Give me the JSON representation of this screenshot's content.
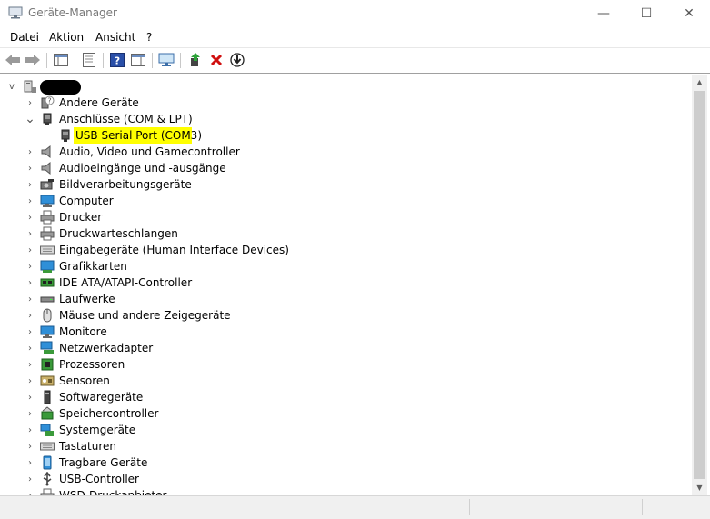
{
  "window": {
    "title": "Geräte-Manager"
  },
  "window_controls": {
    "minimize": "—",
    "maximize": "☐",
    "close": "✕"
  },
  "menu": [
    "Datei",
    "Aktion",
    "Ansicht",
    "?"
  ],
  "tree": {
    "root_expander": "v",
    "collapsed_glyph": "›",
    "expanded_glyph": "⌄",
    "categories": [
      {
        "label": "Andere Geräte",
        "icon": "unknown-device-icon",
        "expanded": false
      },
      {
        "label": "Anschlüsse (COM & LPT)",
        "icon": "port-icon",
        "expanded": true
      },
      {
        "label": "USB Serial Port (COM3)",
        "icon": "usb-serial-port-icon",
        "child": true,
        "selected": true
      },
      {
        "label": "Audio, Video und Gamecontroller",
        "icon": "speaker-icon",
        "expanded": false
      },
      {
        "label": "Audioeingänge und -ausgänge",
        "icon": "speaker-icon",
        "expanded": false
      },
      {
        "label": "Bildverarbeitungsgeräte",
        "icon": "camera-icon",
        "expanded": false
      },
      {
        "label": "Computer",
        "icon": "monitor-icon",
        "expanded": false
      },
      {
        "label": "Drucker",
        "icon": "printer-icon",
        "expanded": false
      },
      {
        "label": "Druckwarteschlangen",
        "icon": "printer-icon",
        "expanded": false
      },
      {
        "label": "Eingabegeräte (Human Interface Devices)",
        "icon": "keyboard-icon",
        "expanded": false
      },
      {
        "label": "Grafikkarten",
        "icon": "graphics-card-icon",
        "expanded": false
      },
      {
        "label": "IDE ATA/ATAPI-Controller",
        "icon": "ide-controller-icon",
        "expanded": false
      },
      {
        "label": "Laufwerke",
        "icon": "drive-icon",
        "expanded": false
      },
      {
        "label": "Mäuse und andere Zeigegeräte",
        "icon": "mouse-icon",
        "expanded": false
      },
      {
        "label": "Monitore",
        "icon": "monitor-icon",
        "expanded": false
      },
      {
        "label": "Netzwerkadapter",
        "icon": "network-adapter-icon",
        "expanded": false
      },
      {
        "label": "Prozessoren",
        "icon": "processor-icon",
        "expanded": false
      },
      {
        "label": "Sensoren",
        "icon": "sensor-icon",
        "expanded": false
      },
      {
        "label": "Softwaregeräte",
        "icon": "software-device-icon",
        "expanded": false
      },
      {
        "label": "Speichercontroller",
        "icon": "storage-controller-icon",
        "expanded": false
      },
      {
        "label": "Systemgeräte",
        "icon": "system-device-icon",
        "expanded": false
      },
      {
        "label": "Tastaturen",
        "icon": "keyboard-icon",
        "expanded": false
      },
      {
        "label": "Tragbare Geräte",
        "icon": "portable-device-icon",
        "expanded": false
      },
      {
        "label": "USB-Controller",
        "icon": "usb-icon",
        "expanded": false
      },
      {
        "label": "WSD-Druckanbieter",
        "icon": "printer-icon",
        "expanded": false
      }
    ]
  },
  "colors": {
    "selection": "#ffff00",
    "remove": "#d01010",
    "help": "#2a4fa8",
    "monitor": "#2f8fd8"
  }
}
